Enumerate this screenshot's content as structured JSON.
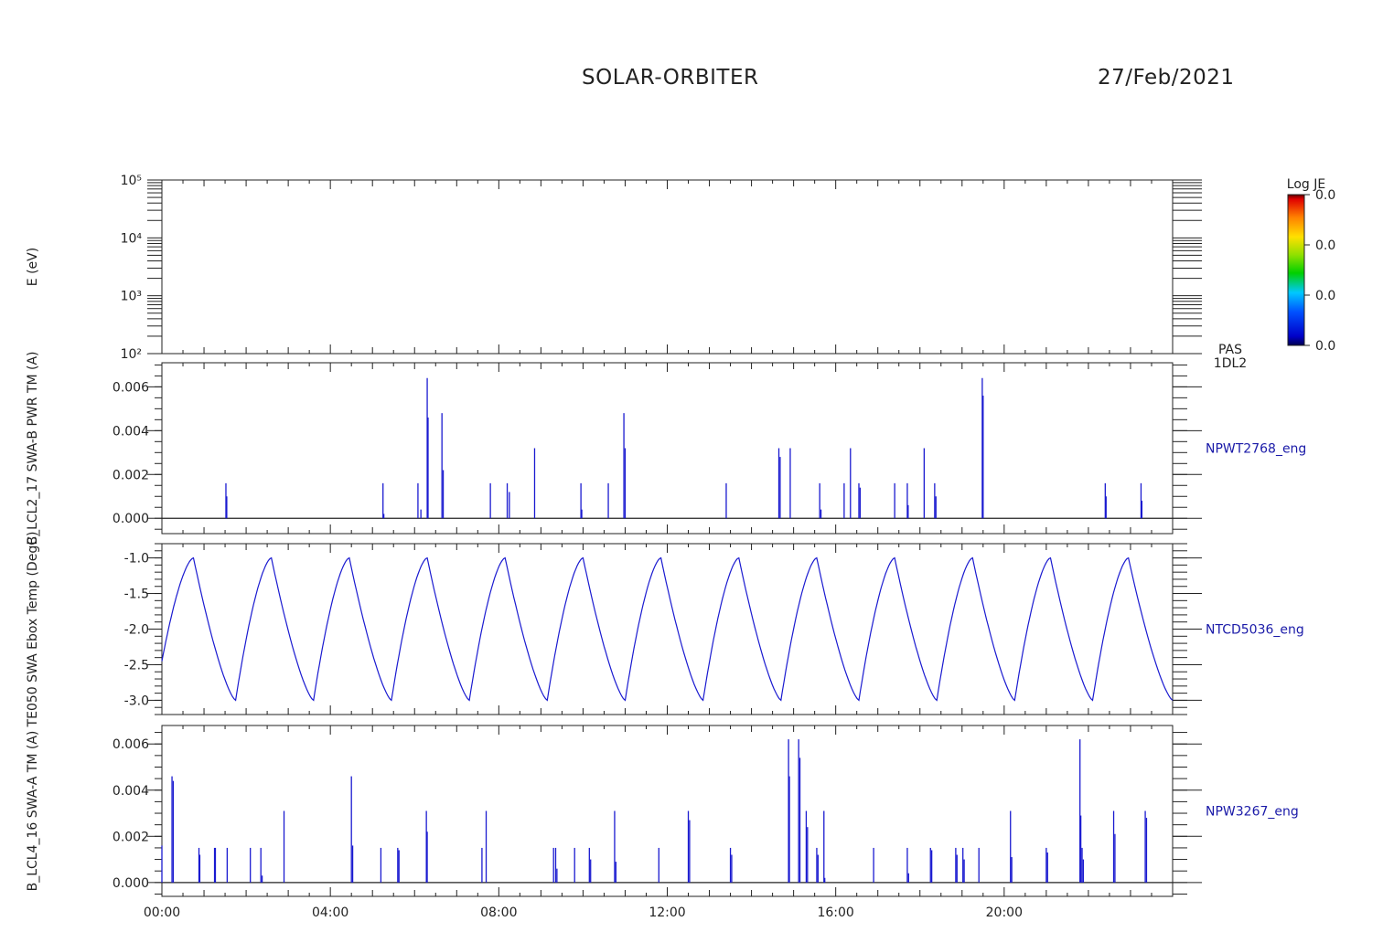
{
  "header": {
    "title": "SOLAR-ORBITER",
    "date": "27/Feb/2021"
  },
  "colorbar": {
    "title": "Log JE",
    "labels": [
      "0.0",
      "0.0",
      "0.0",
      "0.0"
    ]
  },
  "panel_side_labels": {
    "pas_line1": "PAS",
    "pas_line2": "1DL2"
  },
  "colors": {
    "data": "#1a1ad0",
    "axis": "#222222"
  },
  "chart_data": [
    {
      "type": "heatmap",
      "ylabel": "E (eV)",
      "yscale": "log",
      "ylim": [
        100,
        100000
      ],
      "y_ticks": [
        "10²",
        "10³",
        "10⁴",
        "10⁵"
      ],
      "colorbar_label": "Log JE",
      "values": []
    },
    {
      "type": "line",
      "ylabel": "B_LCL2_17 SWA-B PWR TM (A)",
      "series_label": "NPWT2768_eng",
      "ylim": [
        -0.0007,
        0.0071
      ],
      "y_ticks": [
        "0.000",
        "0.002",
        "0.004",
        "0.006"
      ],
      "baseline": 0.0,
      "spikes": [
        [
          1.52,
          0.0016
        ],
        [
          1.54,
          0.001
        ],
        [
          5.25,
          0.0016
        ],
        [
          5.27,
          0.0002
        ],
        [
          6.08,
          0.0016
        ],
        [
          6.15,
          0.0004
        ],
        [
          6.3,
          0.0064
        ],
        [
          6.32,
          0.0046
        ],
        [
          6.65,
          0.0048
        ],
        [
          6.68,
          0.0022
        ],
        [
          7.8,
          0.0016
        ],
        [
          8.2,
          0.0016
        ],
        [
          8.25,
          0.0012
        ],
        [
          8.85,
          0.0032
        ],
        [
          9.95,
          0.0016
        ],
        [
          9.97,
          0.0004
        ],
        [
          10.6,
          0.0016
        ],
        [
          10.97,
          0.0048
        ],
        [
          11.0,
          0.0032
        ],
        [
          13.4,
          0.0016
        ],
        [
          14.65,
          0.0032
        ],
        [
          14.68,
          0.0028
        ],
        [
          14.92,
          0.0032
        ],
        [
          15.62,
          0.0016
        ],
        [
          15.65,
          0.0004
        ],
        [
          16.2,
          0.0016
        ],
        [
          16.35,
          0.0032
        ],
        [
          16.55,
          0.0016
        ],
        [
          16.58,
          0.0014
        ],
        [
          17.4,
          0.0016
        ],
        [
          17.7,
          0.0016
        ],
        [
          17.72,
          0.0006
        ],
        [
          18.1,
          0.0032
        ],
        [
          18.35,
          0.0016
        ],
        [
          18.38,
          0.001
        ],
        [
          19.48,
          0.0064
        ],
        [
          19.5,
          0.0056
        ],
        [
          22.4,
          0.0016
        ],
        [
          22.42,
          0.001
        ],
        [
          23.25,
          0.0016
        ],
        [
          23.27,
          0.0008
        ]
      ]
    },
    {
      "type": "line",
      "ylabel": "TE050 SWA Ebox Temp (DegC)",
      "series_label": "NTCD5036_eng",
      "ylim": [
        -3.2,
        -0.8
      ],
      "y_ticks": [
        "-1.0",
        "-1.5",
        "-2.0",
        "-2.5",
        "-3.0"
      ],
      "peaks": [
        0.75,
        2.6,
        4.45,
        6.3,
        8.15,
        10.0,
        11.85,
        13.7,
        15.55,
        17.4,
        19.25,
        21.1,
        22.95
      ],
      "troughs": [
        1.75,
        3.6,
        5.45,
        7.3,
        9.15,
        11.0,
        12.85,
        14.7,
        16.55,
        18.4,
        20.25,
        22.1,
        24.0
      ],
      "peak_value": -1.0,
      "trough_value": -3.0,
      "start": [
        0.0,
        -2.45
      ]
    },
    {
      "type": "line",
      "ylabel": "B_LCL4_16 SWA-A TM (A)",
      "series_label": "NPW3267_eng",
      "xlabel": "",
      "ylim": [
        -0.0006,
        0.0068
      ],
      "y_ticks": [
        "0.000",
        "0.002",
        "0.004",
        "0.006"
      ],
      "x_ticks": [
        "00:00",
        "04:00",
        "08:00",
        "12:00",
        "16:00",
        "20:00"
      ],
      "xlim": [
        "00:00",
        "24:00"
      ],
      "baseline": 0.0,
      "spikes": [
        [
          0.0,
          0.0016
        ],
        [
          0.24,
          0.0046
        ],
        [
          0.27,
          0.0044
        ],
        [
          0.88,
          0.0015
        ],
        [
          0.9,
          0.0012
        ],
        [
          1.25,
          0.0015
        ],
        [
          1.27,
          0.0015
        ],
        [
          1.55,
          0.0015
        ],
        [
          2.1,
          0.0015
        ],
        [
          2.35,
          0.0015
        ],
        [
          2.38,
          0.0003
        ],
        [
          2.9,
          0.0031
        ],
        [
          4.5,
          0.0046
        ],
        [
          4.53,
          0.0016
        ],
        [
          5.2,
          0.0015
        ],
        [
          5.6,
          0.0015
        ],
        [
          5.63,
          0.0014
        ],
        [
          6.28,
          0.0031
        ],
        [
          6.3,
          0.0022
        ],
        [
          7.6,
          0.0015
        ],
        [
          7.7,
          0.0031
        ],
        [
          9.3,
          0.0015
        ],
        [
          9.35,
          0.0015
        ],
        [
          9.38,
          0.0006
        ],
        [
          9.8,
          0.0015
        ],
        [
          10.15,
          0.0015
        ],
        [
          10.18,
          0.001
        ],
        [
          10.75,
          0.0031
        ],
        [
          10.78,
          0.0009
        ],
        [
          11.8,
          0.0015
        ],
        [
          12.5,
          0.0031
        ],
        [
          12.53,
          0.0027
        ],
        [
          13.5,
          0.0015
        ],
        [
          13.53,
          0.0012
        ],
        [
          14.88,
          0.0062
        ],
        [
          14.9,
          0.0046
        ],
        [
          15.12,
          0.0062
        ],
        [
          15.15,
          0.0054
        ],
        [
          15.3,
          0.0031
        ],
        [
          15.33,
          0.0024
        ],
        [
          15.55,
          0.0015
        ],
        [
          15.58,
          0.0012
        ],
        [
          15.72,
          0.0031
        ],
        [
          15.74,
          0.0002
        ],
        [
          16.9,
          0.0015
        ],
        [
          17.7,
          0.0015
        ],
        [
          17.73,
          0.0004
        ],
        [
          18.25,
          0.0015
        ],
        [
          18.28,
          0.0014
        ],
        [
          18.85,
          0.0015
        ],
        [
          18.88,
          0.0012
        ],
        [
          19.02,
          0.0015
        ],
        [
          19.05,
          0.001
        ],
        [
          19.4,
          0.0015
        ],
        [
          20.15,
          0.0031
        ],
        [
          20.18,
          0.0011
        ],
        [
          21.0,
          0.0015
        ],
        [
          21.03,
          0.0013
        ],
        [
          21.8,
          0.0062
        ],
        [
          21.82,
          0.0029
        ],
        [
          21.85,
          0.0015
        ],
        [
          21.88,
          0.001
        ],
        [
          22.6,
          0.0031
        ],
        [
          22.63,
          0.0021
        ],
        [
          23.35,
          0.0031
        ],
        [
          23.38,
          0.0028
        ]
      ]
    }
  ]
}
